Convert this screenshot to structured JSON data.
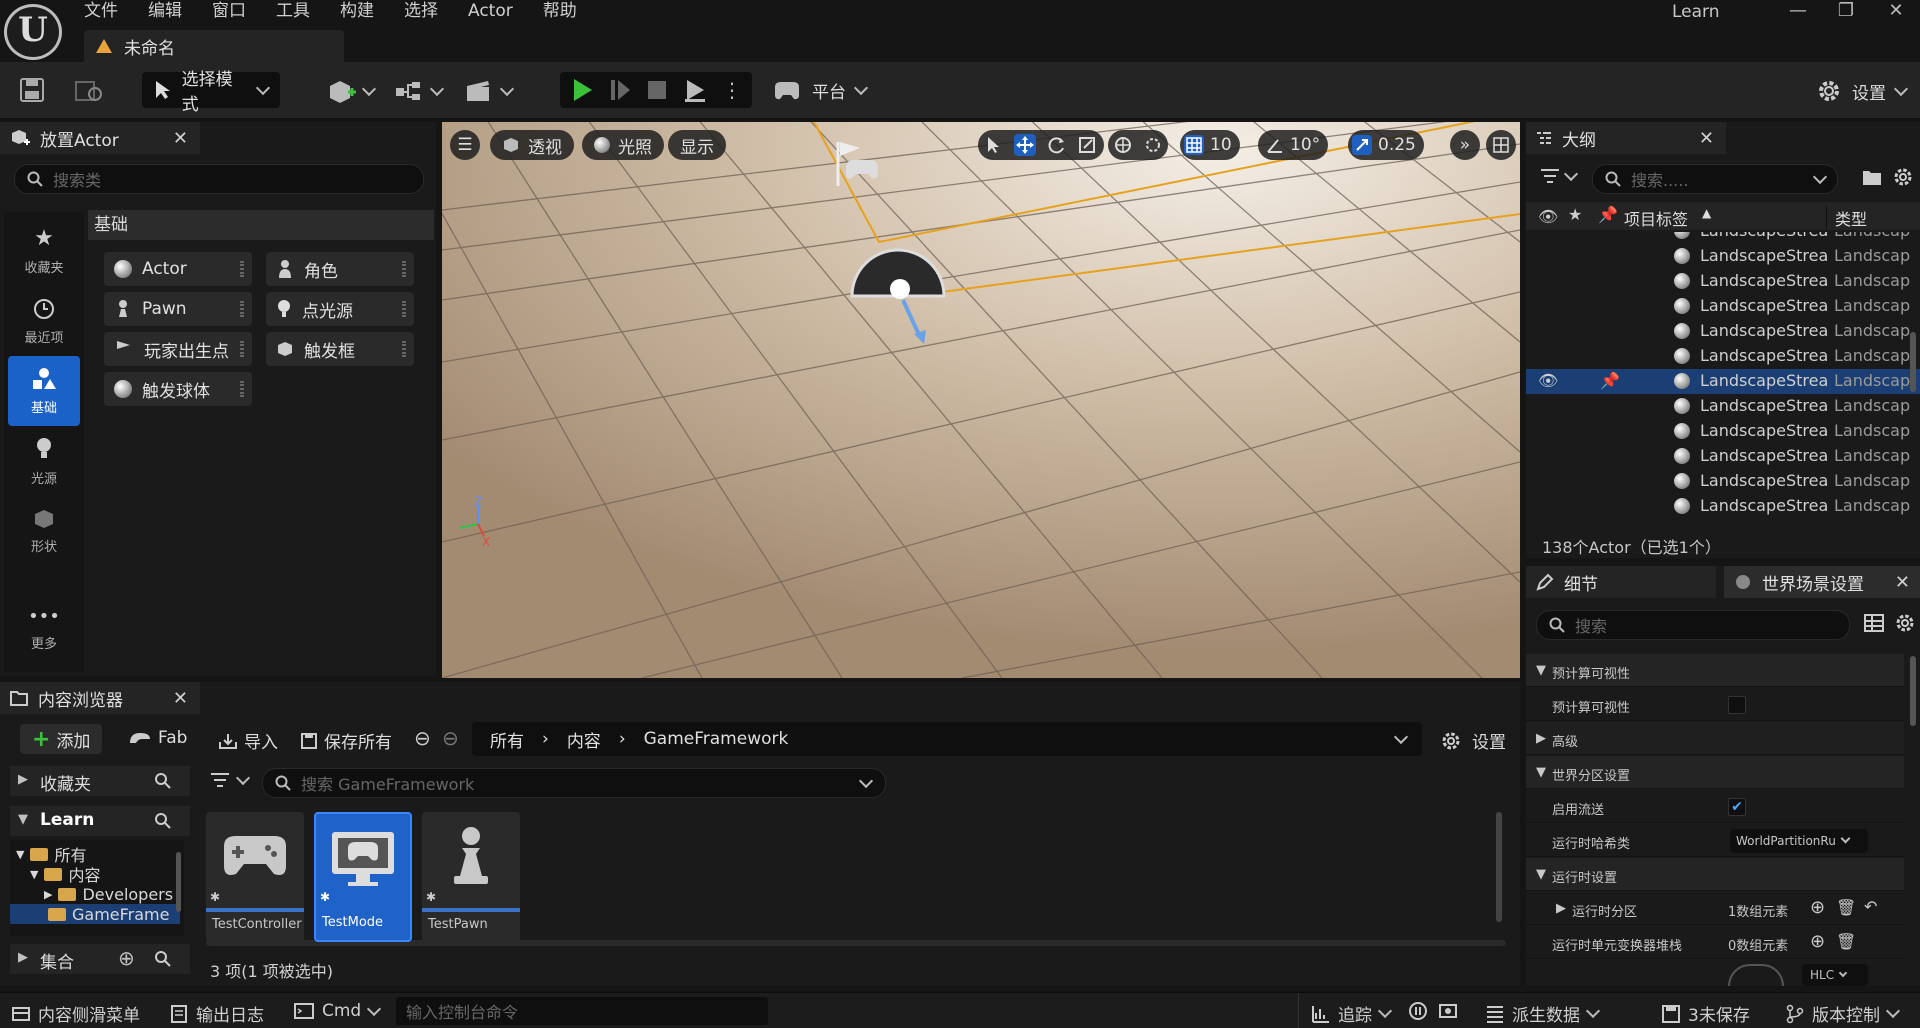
{
  "menu": {
    "items": [
      "文件",
      "编辑",
      "窗口",
      "工具",
      "构建",
      "选择",
      "Actor",
      "帮助"
    ],
    "doc_tab": "未命名",
    "project": "Learn"
  },
  "toolbar": {
    "select_mode": "选择模式",
    "platform": "平台",
    "settings": "设置"
  },
  "place_actor": {
    "tab_title": "放置Actor",
    "search_placeholder": "搜索类",
    "categories": [
      "收藏夹",
      "最近项",
      "基础",
      "光源",
      "形状",
      "更多"
    ],
    "section": "基础",
    "items": [
      "Actor",
      "角色",
      "Pawn",
      "点光源",
      "玩家出生点",
      "触发框",
      "触发球体"
    ]
  },
  "viewport": {
    "perspective": "透视",
    "lighting": "光照",
    "show": "显示",
    "grid_snap": "10",
    "rot_snap": "10°",
    "scale_snap": "0.25",
    "accent": "#2f7cf6"
  },
  "outliner": {
    "tab_title": "大纲",
    "search_placeholder": "搜索.....",
    "col_label": "项目标签",
    "col_type": "类型",
    "rows": [
      {
        "label": "LandscapeStrea",
        "type": "Landscap"
      },
      {
        "label": "LandscapeStrea",
        "type": "Landscap"
      },
      {
        "label": "LandscapeStrea",
        "type": "Landscap"
      },
      {
        "label": "LandscapeStrea",
        "type": "Landscap"
      },
      {
        "label": "LandscapeStrea",
        "type": "Landscap"
      },
      {
        "label": "LandscapeStrea",
        "type": "Landscap"
      },
      {
        "label": "LandscapeStrea",
        "type": "Landscap"
      },
      {
        "label": "LandscapeStrea",
        "type": "Landscap"
      },
      {
        "label": "LandscapeStrea",
        "type": "Landscap"
      },
      {
        "label": "LandscapeStrea",
        "type": "Landscap"
      },
      {
        "label": "LandscapeStrea",
        "type": "Landscap"
      },
      {
        "label": "LandscapeStrea",
        "type": "Landscap"
      }
    ],
    "count": "138个Actor（已选1个）"
  },
  "details": {
    "tab_title": "细节",
    "tab2_title": "世界场景设置",
    "search_placeholder": "搜索",
    "rows": [
      {
        "text": "预计算可视性"
      },
      {
        "text": "预计算可视性"
      },
      {
        "text": "高级"
      },
      {
        "text": "世界分区设置"
      },
      {
        "text": "启用流送"
      },
      {
        "text": "运行时哈希类",
        "value": "WorldPartitionRu"
      },
      {
        "text": "运行时设置"
      },
      {
        "text": "运行时分区",
        "value": "1数组元素"
      },
      {
        "text": "运行时单元变换器堆栈",
        "value": "0数组元素"
      }
    ],
    "hlc": "HLC"
  },
  "content_browser": {
    "tab_title": "内容浏览器",
    "add": "添加",
    "fab": "Fab",
    "import": "导入",
    "save_all": "保存所有",
    "path": [
      "所有",
      "内容",
      "GameFramework"
    ],
    "settings": "设置",
    "favorites": "收藏夹",
    "project": "Learn",
    "search_placeholder": "搜索 GameFramework",
    "tree": [
      "所有",
      "内容",
      "Developers",
      "GameFrame"
    ],
    "collections": "集合",
    "assets": [
      "TestController",
      "TestMode",
      "TestPawn"
    ],
    "count": "3 项(1 项被选中)"
  },
  "statusbar": {
    "drawer": "内容侧滑菜单",
    "output_log": "输出日志",
    "cmd": "Cmd",
    "console_placeholder": "输入控制台命令",
    "trace": "追踪",
    "derived_data": "派生数据",
    "unsaved": "3未保存",
    "source_control": "版本控制"
  }
}
